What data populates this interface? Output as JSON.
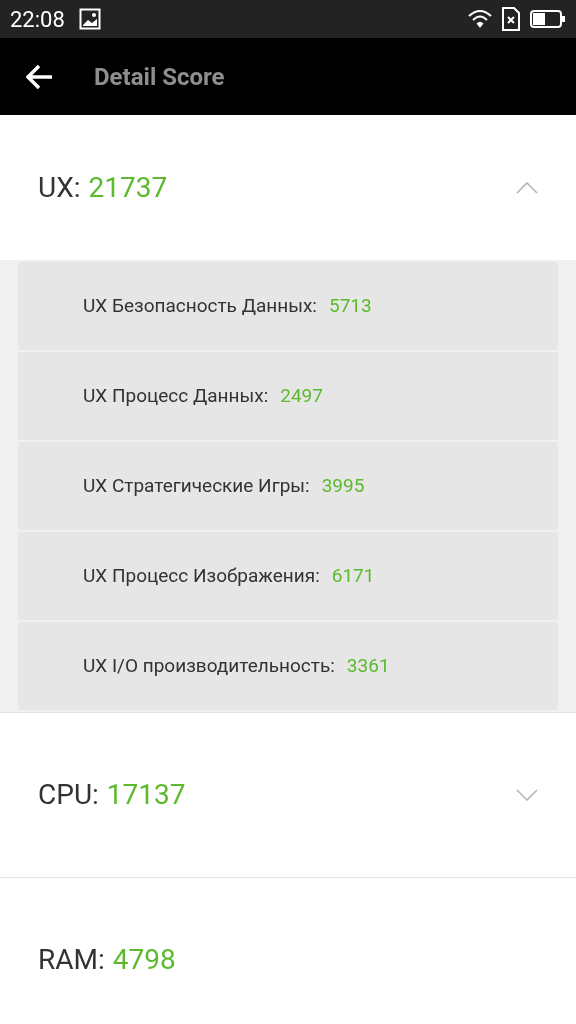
{
  "status_bar": {
    "time": "22:08"
  },
  "app_bar": {
    "title": "Detail Score"
  },
  "sections": [
    {
      "label": "UX:",
      "score": "21737",
      "expanded": true,
      "items": [
        {
          "label": "UX Безопасность Данных:",
          "score": "5713"
        },
        {
          "label": "UX Процесс Данных:",
          "score": "2497"
        },
        {
          "label": "UX Стратегические Игры:",
          "score": "3995"
        },
        {
          "label": "UX Процесс Изображения:",
          "score": "6171"
        },
        {
          "label": "UX I/O производительность:",
          "score": "3361"
        }
      ]
    },
    {
      "label": "CPU:",
      "score": "17137",
      "expanded": false
    },
    {
      "label": "RAM:",
      "score": "4798"
    }
  ]
}
